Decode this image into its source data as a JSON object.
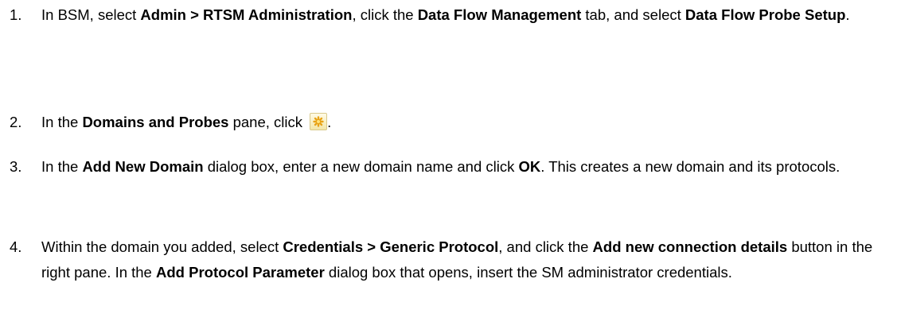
{
  "steps": [
    {
      "number": "1.",
      "parts": [
        {
          "t": "In BSM, select "
        },
        {
          "t": "Admin > RTSM Administration",
          "b": true
        },
        {
          "t": ", click the "
        },
        {
          "t": "Data Flow Management",
          "b": true
        },
        {
          "t": " tab, and select "
        },
        {
          "t": "Data Flow Probe Setup",
          "b": true
        },
        {
          "t": "."
        }
      ]
    },
    {
      "number": "2.",
      "parts": [
        {
          "t": "In the "
        },
        {
          "t": "Domains and Probes",
          "b": true
        },
        {
          "t": " pane, click "
        },
        {
          "icon": "new-star-icon"
        },
        {
          "t": "."
        }
      ]
    },
    {
      "number": "3.",
      "parts": [
        {
          "t": "In the "
        },
        {
          "t": "Add New Domain",
          "b": true
        },
        {
          "t": " dialog box, enter a new domain name and click "
        },
        {
          "t": "OK",
          "b": true
        },
        {
          "t": ". This creates a new domain and its protocols."
        }
      ]
    },
    {
      "number": "4.",
      "parts": [
        {
          "t": "Within the domain you added, select "
        },
        {
          "t": "Credentials > Generic Protocol",
          "b": true
        },
        {
          "t": ", and click the "
        },
        {
          "t": "Add new connection details",
          "b": true
        },
        {
          "t": " button in the right pane. In the "
        },
        {
          "t": "Add Protocol Parameter",
          "b": true
        },
        {
          "t": " dialog box that opens, insert the SM administrator credentials."
        }
      ]
    }
  ]
}
